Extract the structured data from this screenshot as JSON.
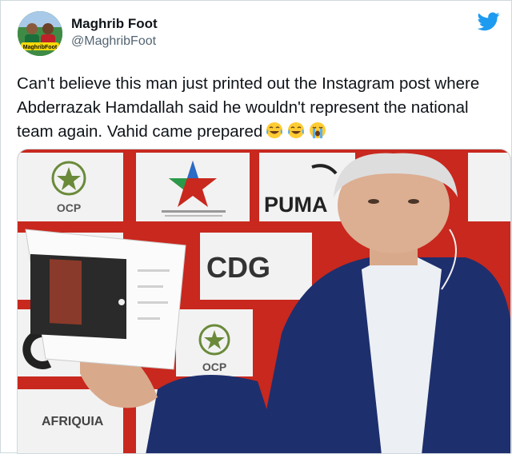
{
  "author": {
    "display_name": "Maghrib Foot",
    "handle": "@MaghribFoot",
    "avatar_caption": "MaghribFoot"
  },
  "tweet": {
    "text": "Can't believe this man just printed out the Instagram post where Abderrazak Hamdallah said he wouldn't represent the national team again. Vahid came prepared",
    "emojis": [
      "face-with-tears-of-joy",
      "face-with-tears-of-joy",
      "loudly-crying-face"
    ]
  },
  "media": {
    "sponsor_logos": [
      "OCP",
      "PUMA",
      "CDG",
      "AFRIQUIA"
    ]
  },
  "colors": {
    "brand_blue": "#1d9bf0",
    "handle_gray": "#536471",
    "backdrop_red": "#c8281e"
  }
}
